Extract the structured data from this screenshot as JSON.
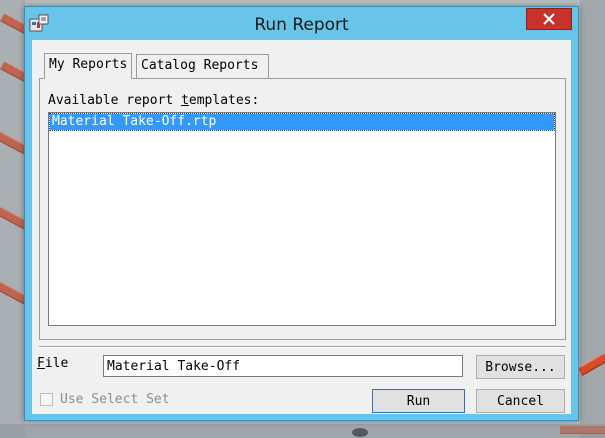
{
  "window": {
    "title": "Run Report"
  },
  "tabs": [
    {
      "label": "My Reports",
      "active": true
    },
    {
      "label": "Catalog Reports",
      "active": false
    }
  ],
  "templates": {
    "label_pre": "Available report ",
    "label_accel": "t",
    "label_post": "emplates:",
    "items": [
      "Material Take-Off.rtp"
    ],
    "selected": "Material Take-Off.rtp"
  },
  "file": {
    "label_accel": "F",
    "label_post": "ile",
    "value": "Material Take-Off"
  },
  "buttons": {
    "browse": "Browse...",
    "run": "Run",
    "cancel": "Cancel"
  },
  "use_select_set": {
    "label": "Use Select Set",
    "checked": false,
    "enabled": false
  },
  "colors": {
    "title_bar": "#68c4e9",
    "close_button": "#c7322b",
    "selection": "#3399ff"
  }
}
